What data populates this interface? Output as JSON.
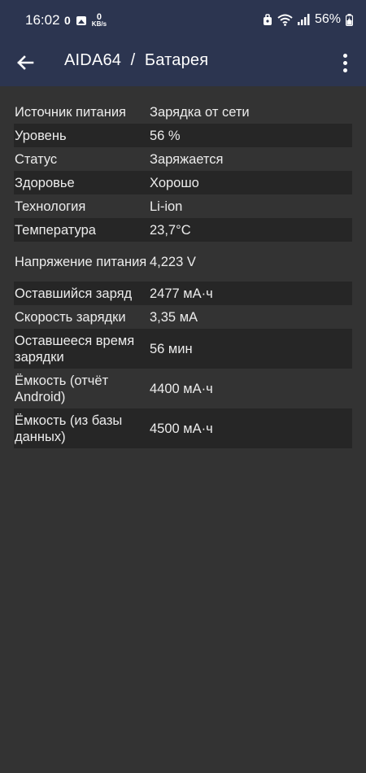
{
  "status_bar": {
    "time": "16:02",
    "notif_count": "0",
    "kbs_value": "0",
    "kbs_unit": "KB/s",
    "battery_percent": "56%"
  },
  "app_bar": {
    "title": "AIDA64  /  Батарея",
    "back_icon": "arrow-left-icon",
    "menu_icon": "more-vert-icon"
  },
  "rows": [
    {
      "label": "Источник питания",
      "value": "Зарядка от сети"
    },
    {
      "label": "Уровень",
      "value": "56 %"
    },
    {
      "label": "Статус",
      "value": "Заряжается"
    },
    {
      "label": "Здоровье",
      "value": "Хорошо"
    },
    {
      "label": "Технология",
      "value": "Li-ion"
    },
    {
      "label": "Температура",
      "value": "23,7°C"
    },
    {
      "label": "Напряжение питания",
      "value": "4,223 V"
    },
    {
      "label": "Оставшийся заряд",
      "value": "2477 мА·ч"
    },
    {
      "label": "Скорость зарядки",
      "value": "3,35 мА"
    },
    {
      "label": "Оставшееся время зарядки",
      "value": "56 мин"
    },
    {
      "label": "Ёмкость (отчёт Android)",
      "value": "4400 мА·ч"
    },
    {
      "label": "Ёмкость (из базы данных)",
      "value": "4500 мА·ч"
    }
  ],
  "colors": {
    "app_bar": "#2c3550",
    "background": "#333333",
    "row_alt": "#262626",
    "text": "#ececec"
  }
}
